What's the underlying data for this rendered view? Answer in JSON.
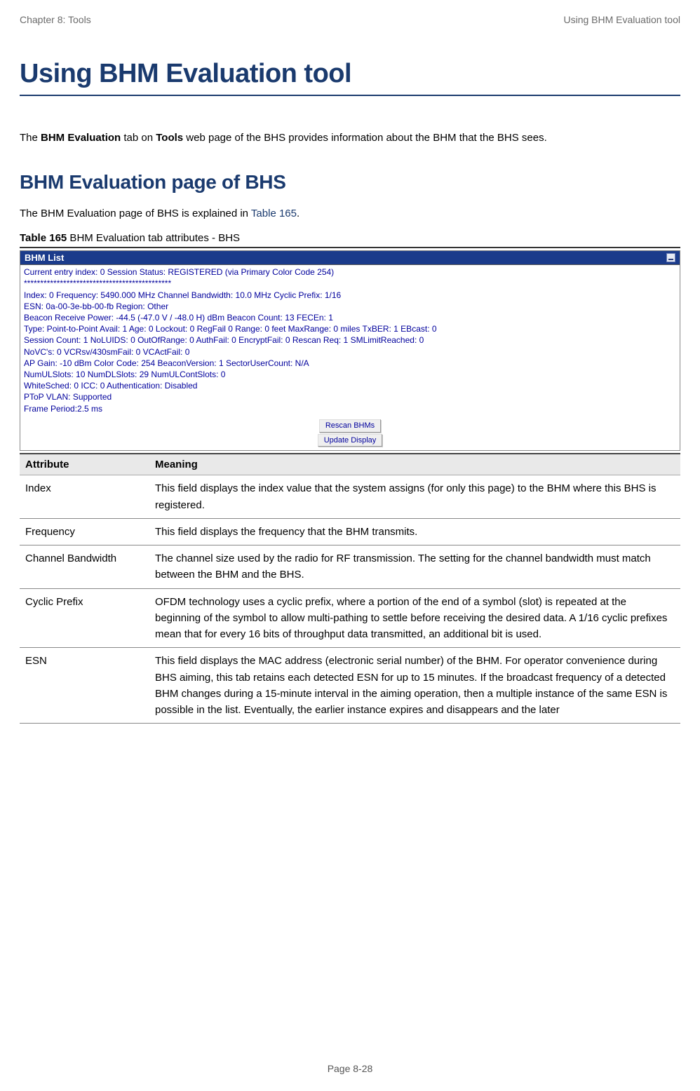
{
  "header": {
    "left": "Chapter 8:  Tools",
    "right": "Using BHM Evaluation tool"
  },
  "title": "Using BHM Evaluation tool",
  "intro": {
    "prefix": "The ",
    "bold1": "BHM Evaluation",
    "mid": " tab on ",
    "bold2": "Tools",
    "suffix": " web page of the BHS provides information about the BHM that the BHS sees."
  },
  "subheading": "BHM Evaluation page of BHS",
  "explain": {
    "prefix": "The BHM Evaluation page of BHS is explained in ",
    "link": "Table 165",
    "suffix": "."
  },
  "table_caption": {
    "bold": "Table 165",
    "rest": " BHM Evaluation tab attributes - BHS"
  },
  "bhm_panel": {
    "title": "BHM List",
    "lines": [
      "Current entry index: 0 Session Status: REGISTERED (via Primary Color Code 254)",
      "",
      "*********************************************",
      "Index: 0 Frequency: 5490.000 MHz  Channel Bandwidth: 10.0 MHz  Cyclic Prefix: 1/16",
      "ESN: 0a-00-3e-bb-00-fb Region: Other",
      "Beacon Receive Power: -44.5 (-47.0 V / -48.0 H) dBm Beacon Count: 13 FECEn: 1",
      "Type: Point-to-Point Avail: 1 Age: 0 Lockout: 0 RegFail 0 Range: 0 feet MaxRange: 0 miles TxBER: 1 EBcast: 0",
      "Session Count: 1 NoLUIDS: 0 OutOfRange: 0 AuthFail: 0 EncryptFail: 0 Rescan Req: 1 SMLimitReached: 0",
      "NoVC's: 0 VCRsv/430smFail: 0 VCActFail: 0",
      "AP Gain: -10 dBm Color Code: 254 BeaconVersion: 1 SectorUserCount: N/A",
      "NumULSlots: 10 NumDLSlots: 29 NumULContSlots: 0",
      "WhiteSched: 0 ICC: 0 Authentication: Disabled",
      "PToP VLAN: Supported",
      "Frame Period:2.5 ms"
    ],
    "buttons": {
      "rescan": "Rescan BHMs",
      "update": "Update Display"
    }
  },
  "attr_table": {
    "headers": {
      "attribute": "Attribute",
      "meaning": "Meaning"
    },
    "rows": [
      {
        "attr": "Index",
        "meaning": "This field displays the index value that the system assigns (for only this page) to the BHM where this BHS is registered."
      },
      {
        "attr": "Frequency",
        "meaning": "This field displays the frequency that the BHM transmits."
      },
      {
        "attr": "Channel Bandwidth",
        "meaning": "The channel size used by the radio for RF transmission. The setting for the channel bandwidth must match between the BHM and the BHS."
      },
      {
        "attr": "Cyclic Prefix",
        "meaning": "OFDM technology uses a cyclic prefix, where a portion of the end of a symbol (slot) is repeated at the beginning of the symbol to allow multi-pathing to settle before receiving the desired data. A 1/16 cyclic prefixes mean that for every 16 bits of throughput data transmitted, an additional bit is used."
      },
      {
        "attr": "ESN",
        "meaning": "This field displays the MAC address (electronic serial number) of the BHM. For operator convenience during BHS aiming, this tab retains each detected ESN for up to 15 minutes. If the broadcast frequency of a detected BHM changes during a 15-minute interval in the aiming operation, then a multiple instance of the same ESN is possible in the list. Eventually, the earlier instance expires and disappears and the later"
      }
    ]
  },
  "footer": "Page 8-28"
}
